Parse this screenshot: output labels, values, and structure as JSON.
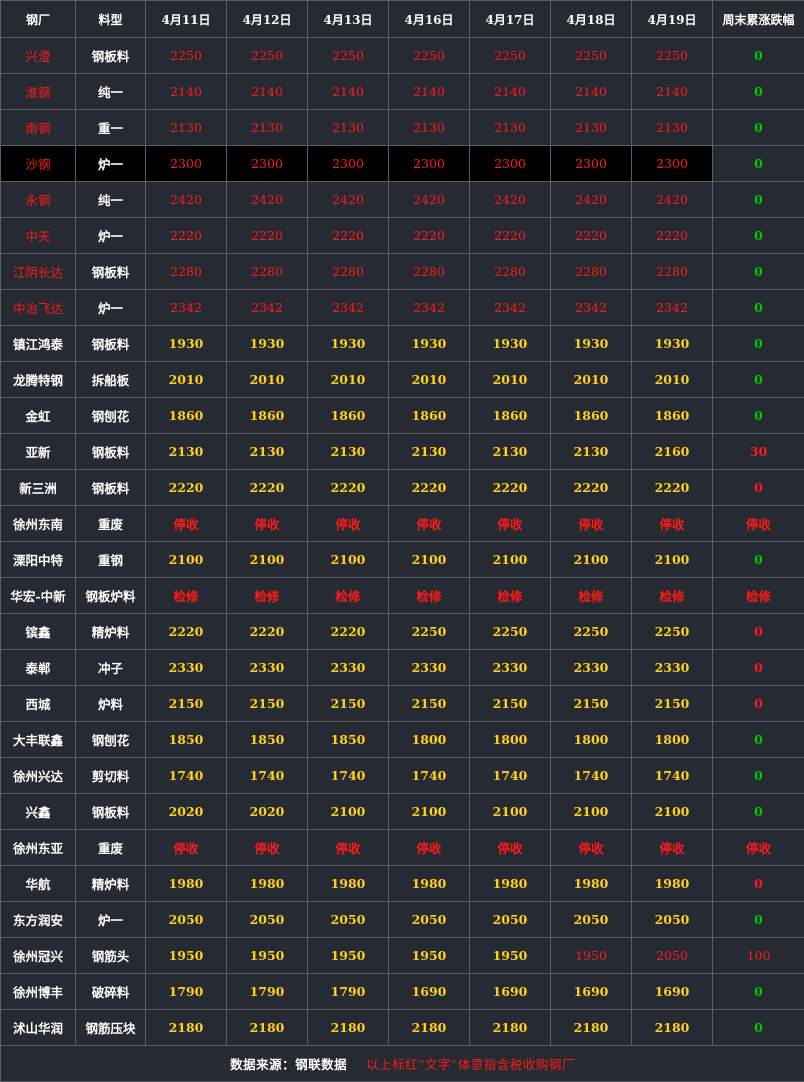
{
  "headers": [
    "钢厂",
    "料型",
    "4月11日",
    "4月12日",
    "4月13日",
    "4月16日",
    "4月17日",
    "4月18日",
    "4月19日",
    "周末累涨跌幅"
  ],
  "rows": [
    {
      "mill": "兴澄",
      "mat": "钢板料",
      "prices": [
        "2250",
        "2250",
        "2250",
        "2250",
        "2250",
        "2250",
        "2250"
      ],
      "change": "0",
      "style": "red"
    },
    {
      "mill": "淮钢",
      "mat": "纯一",
      "prices": [
        "2140",
        "2140",
        "2140",
        "2140",
        "2140",
        "2140",
        "2140"
      ],
      "change": "0",
      "style": "red"
    },
    {
      "mill": "南钢",
      "mat": "重一",
      "prices": [
        "2130",
        "2130",
        "2130",
        "2130",
        "2130",
        "2130",
        "2130"
      ],
      "change": "0",
      "style": "red"
    },
    {
      "mill": "沙钢",
      "mat": "炉一",
      "prices": [
        "2300",
        "2300",
        "2300",
        "2300",
        "2300",
        "2300",
        "2300"
      ],
      "change": "0",
      "style": "red",
      "highlight": true
    },
    {
      "mill": "永钢",
      "mat": "纯一",
      "prices": [
        "2420",
        "2420",
        "2420",
        "2420",
        "2420",
        "2420",
        "2420"
      ],
      "change": "0",
      "style": "red"
    },
    {
      "mill": "中天",
      "mat": "炉一",
      "prices": [
        "2220",
        "2220",
        "2220",
        "2220",
        "2220",
        "2220",
        "2220"
      ],
      "change": "0",
      "style": "red"
    },
    {
      "mill": "江阴长达",
      "mat": "钢板料",
      "prices": [
        "2280",
        "2280",
        "2280",
        "2280",
        "2280",
        "2280",
        "2280"
      ],
      "change": "0",
      "style": "red"
    },
    {
      "mill": "中冶飞达",
      "mat": "炉一",
      "prices": [
        "2342",
        "2342",
        "2342",
        "2342",
        "2342",
        "2342",
        "2342"
      ],
      "change": "0",
      "style": "red"
    },
    {
      "mill": "镇江鸿泰",
      "mat": "钢板料",
      "prices": [
        "1930",
        "1930",
        "1930",
        "1930",
        "1930",
        "1930",
        "1930"
      ],
      "change": "0",
      "style": "normal"
    },
    {
      "mill": "龙腾特钢",
      "mat": "拆船板",
      "prices": [
        "2010",
        "2010",
        "2010",
        "2010",
        "2010",
        "2010",
        "2010"
      ],
      "change": "0",
      "style": "normal"
    },
    {
      "mill": "金虹",
      "mat": "钢刨花",
      "prices": [
        "1860",
        "1860",
        "1860",
        "1860",
        "1860",
        "1860",
        "1860"
      ],
      "change": "0",
      "style": "normal"
    },
    {
      "mill": "亚新",
      "mat": "钢板料",
      "prices": [
        "2130",
        "2130",
        "2130",
        "2130",
        "2130",
        "2130",
        "2160"
      ],
      "change": "30",
      "style": "normal"
    },
    {
      "mill": "新三洲",
      "mat": "钢板料",
      "prices": [
        "2220",
        "2220",
        "2220",
        "2220",
        "2220",
        "2220",
        "2220"
      ],
      "change": "0",
      "style": "normal",
      "changeRed": true
    },
    {
      "mill": "徐州东南",
      "mat": "重废",
      "prices": [
        "停收",
        "停收",
        "停收",
        "停收",
        "停收",
        "停收",
        "停收"
      ],
      "change": "停收",
      "style": "normal",
      "stop": true
    },
    {
      "mill": "溧阳中特",
      "mat": "重钢",
      "prices": [
        "2100",
        "2100",
        "2100",
        "2100",
        "2100",
        "2100",
        "2100"
      ],
      "change": "0",
      "style": "normal"
    },
    {
      "mill": "华宏-中新",
      "mat": "钢板炉料",
      "prices": [
        "检修",
        "检修",
        "检修",
        "检修",
        "检修",
        "检修",
        "检修"
      ],
      "change": "检修",
      "style": "normal",
      "stop": true
    },
    {
      "mill": "镔鑫",
      "mat": "精炉料",
      "prices": [
        "2220",
        "2220",
        "2220",
        "2250",
        "2250",
        "2250",
        "2250"
      ],
      "change": "0",
      "style": "normal",
      "changeRed": true
    },
    {
      "mill": "泰郸",
      "mat": "冲子",
      "prices": [
        "2330",
        "2330",
        "2330",
        "2330",
        "2330",
        "2330",
        "2330"
      ],
      "change": "0",
      "style": "normal",
      "changeRed": true
    },
    {
      "mill": "西城",
      "mat": "炉料",
      "prices": [
        "2150",
        "2150",
        "2150",
        "2150",
        "2150",
        "2150",
        "2150"
      ],
      "change": "0",
      "style": "normal",
      "changeRed": true
    },
    {
      "mill": "大丰联鑫",
      "mat": "钢刨花",
      "prices": [
        "1850",
        "1850",
        "1850",
        "1800",
        "1800",
        "1800",
        "1800"
      ],
      "change": "0",
      "style": "normal"
    },
    {
      "mill": "徐州兴达",
      "mat": "剪切料",
      "prices": [
        "1740",
        "1740",
        "1740",
        "1740",
        "1740",
        "1740",
        "1740"
      ],
      "change": "0",
      "style": "normal"
    },
    {
      "mill": "兴鑫",
      "mat": "钢板料",
      "prices": [
        "2020",
        "2020",
        "2100",
        "2100",
        "2100",
        "2100",
        "2100"
      ],
      "change": "0",
      "style": "normal"
    },
    {
      "mill": "徐州东亚",
      "mat": "重废",
      "prices": [
        "停收",
        "停收",
        "停收",
        "停收",
        "停收",
        "停收",
        "停收"
      ],
      "change": "停收",
      "style": "normal",
      "stop": true
    },
    {
      "mill": "华航",
      "mat": "精炉料",
      "prices": [
        "1980",
        "1980",
        "1980",
        "1980",
        "1980",
        "1980",
        "1980"
      ],
      "change": "0",
      "style": "normal",
      "changeRed": true
    },
    {
      "mill": "东方润安",
      "mat": "炉一",
      "prices": [
        "2050",
        "2050",
        "2050",
        "2050",
        "2050",
        "2050",
        "2050"
      ],
      "change": "0",
      "style": "normal"
    },
    {
      "mill": "徐州冠兴",
      "mat": "钢筋头",
      "prices": [
        "1950",
        "1950",
        "1950",
        "1950",
        "1950",
        "1950",
        "2050"
      ],
      "change": "100",
      "style": "normal",
      "redFrom": 5,
      "changeUp": true
    },
    {
      "mill": "徐州博丰",
      "mat": "破碎料",
      "prices": [
        "1790",
        "1790",
        "1790",
        "1690",
        "1690",
        "1690",
        "1690"
      ],
      "change": "0",
      "style": "normal"
    },
    {
      "mill": "沭山华润",
      "mat": "钢筋压块",
      "prices": [
        "2180",
        "2180",
        "2180",
        "2180",
        "2180",
        "2180",
        "2180"
      ],
      "change": "0",
      "style": "normal"
    }
  ],
  "footer": {
    "source": "数据来源：钢联数据",
    "note": "以上标红“文字”体意指含税收购钢厂"
  },
  "colors": {
    "red": "#ff1a1a",
    "yellow": "#ffd21a",
    "green": "#00c800",
    "background": "#262b33"
  }
}
